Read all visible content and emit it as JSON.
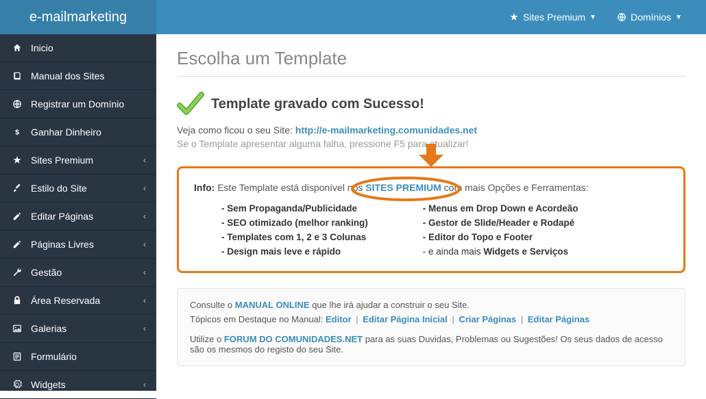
{
  "brand": "e-mailmarketing",
  "topbar": {
    "premium": "Sites Premium",
    "domains": "Domínios"
  },
  "sidebar": {
    "items": [
      {
        "label": "Inicio",
        "expandable": false
      },
      {
        "label": "Manual dos Sites",
        "expandable": false
      },
      {
        "label": "Registrar um Domínio",
        "expandable": false
      },
      {
        "label": "Ganhar Dinheiro",
        "expandable": false
      },
      {
        "label": "Sites Premium",
        "expandable": true
      },
      {
        "label": "Estilo do Site",
        "expandable": true
      },
      {
        "label": "Editar Páginas",
        "expandable": true
      },
      {
        "label": "Páginas Livres",
        "expandable": true
      },
      {
        "label": "Gestão",
        "expandable": true
      },
      {
        "label": "Área Reservada",
        "expandable": true
      },
      {
        "label": "Galerias",
        "expandable": true
      },
      {
        "label": "Formulário",
        "expandable": false
      },
      {
        "label": "Widgets",
        "expandable": true
      }
    ]
  },
  "page": {
    "title": "Escolha um Template",
    "success_title": "Template gravado com Sucesso!",
    "see_prefix": "Veja como ficou o seu Site: ",
    "site_url": "http://e-mailmarketing.comunidades.net",
    "refresh_hint": "Se o Template apresentar alguma falha, pressione F5 para atualizar!"
  },
  "info": {
    "label": "Info:",
    "before": " Este Template está disponível nos ",
    "premium_text": "SITES PREMIUM",
    "after": " com mais Opções e Ferramentas:",
    "features_left": [
      "- Sem Propaganda/Publicidade",
      "- SEO otimizado (melhor ranking)",
      "- Templates com 1, 2 e 3 Colunas",
      "- Design mais leve e rápido"
    ],
    "features_right": [
      "- Menus em Drop Down e Acordeão",
      "- Gestor de Slide/Header e Rodapé",
      "- Editor do Topo e Footer"
    ],
    "features_right_last_prefix": "- e ainda mais ",
    "features_right_last_bold": "Widgets e Serviços"
  },
  "help": {
    "line1_a": "Consulte o ",
    "manual": "MANUAL ONLINE",
    "line1_b": " que lhe irá ajudar a construir o seu Site.",
    "topics_prefix": "Tópicos em Destaque no Manual: ",
    "topics": [
      "Editor",
      "Editar Página Inicial",
      "Criar Páginas",
      "Editar Páginas"
    ],
    "line3_a": "Utilize o ",
    "forum": "FORUM DO COMUNIDADES.NET",
    "line3_b": " para as suas Duvidas, Problemas ou Sugestões! Os seus dados de acesso são os mesmos do registo do seu Site."
  }
}
